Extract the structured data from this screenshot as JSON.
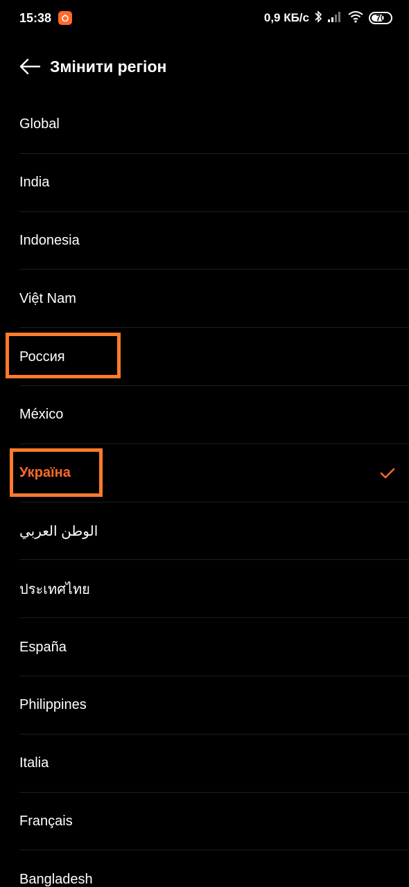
{
  "status_bar": {
    "time": "15:38",
    "speed": "0,9 КБ/с",
    "battery_percent": "70",
    "battery_level": 0.7,
    "icons": [
      "app-badge-icon",
      "bluetooth-icon",
      "signal-icon",
      "wifi-icon",
      "battery-icon"
    ]
  },
  "header": {
    "title": "Змінити регіон",
    "back_icon": "arrow-left-icon"
  },
  "regions": [
    "Global",
    "India",
    "Indonesia",
    "Việt Nam",
    "Россия",
    "México",
    "Україна",
    "الوطن العربي",
    "ประเทศไทย",
    "España",
    "Philippines",
    "Italia",
    "Français",
    "Bangladesh"
  ],
  "selected_region": "Україна",
  "highlighted_regions": [
    "Россия",
    "Україна"
  ],
  "colors": {
    "background": "#000000",
    "accent": "#ff6a2b",
    "highlight_border": "#ff7a2b",
    "text": "#ffffff",
    "divider": "#1e1e1e"
  }
}
